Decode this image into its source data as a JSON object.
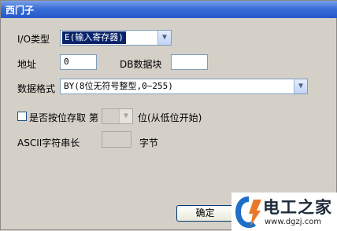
{
  "window": {
    "title": "西门子"
  },
  "io_type": {
    "label": "I/O类型",
    "value": "E(输入寄存器)"
  },
  "address": {
    "label": "地址",
    "value": "0"
  },
  "db_block": {
    "label": "DB数据块",
    "value": ""
  },
  "data_format": {
    "label": "数据格式",
    "value": "BY(8位无符号整型,0~255)"
  },
  "bit_access": {
    "checkbox_label": "是否按位存取",
    "bit_prefix": "第",
    "bit_value": "",
    "bit_suffix": "位(从低位开始)"
  },
  "ascii": {
    "label": "ASCII字符串长",
    "value": "",
    "unit": "字节"
  },
  "buttons": {
    "ok": "确定"
  },
  "watermark": {
    "brand": "电工之家",
    "url": "www.dgzj.com"
  },
  "colors": {
    "title_bar": "#2458c8",
    "dialog_bg": "#d4d0c8",
    "selection": "#0a246a",
    "logo_blue": "#1e6fc5",
    "logo_orange": "#e8792a"
  },
  "icons": {
    "dropdown": "chevron-down-icon",
    "logo": "dgzj-logo-icon"
  }
}
